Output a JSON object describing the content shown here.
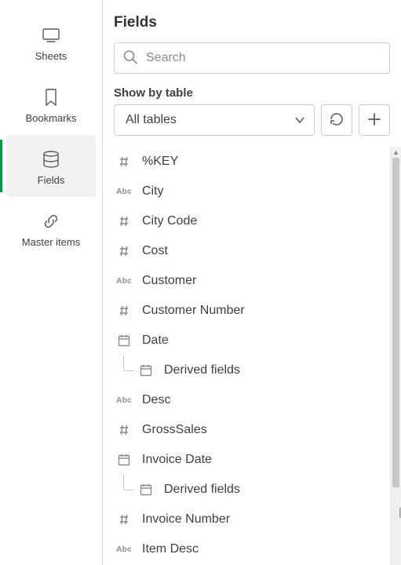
{
  "sidebar": {
    "items": [
      {
        "label": "Sheets"
      },
      {
        "label": "Bookmarks"
      },
      {
        "label": "Fields"
      },
      {
        "label": "Master items"
      }
    ],
    "activeIndex": 2
  },
  "panel": {
    "title": "Fields",
    "search_placeholder": "Search",
    "showby_label": "Show by table",
    "table_select_value": "All tables"
  },
  "fields": [
    {
      "type": "num",
      "label": "%KEY"
    },
    {
      "type": "text",
      "label": "City"
    },
    {
      "type": "num",
      "label": "City Code"
    },
    {
      "type": "num",
      "label": "Cost"
    },
    {
      "type": "text",
      "label": "Customer"
    },
    {
      "type": "num",
      "label": "Customer Number"
    },
    {
      "type": "date",
      "label": "Date"
    },
    {
      "type": "date",
      "label": "Derived fields",
      "child": true
    },
    {
      "type": "text",
      "label": "Desc"
    },
    {
      "type": "num",
      "label": "GrossSales"
    },
    {
      "type": "date",
      "label": "Invoice Date"
    },
    {
      "type": "date",
      "label": "Derived fields",
      "child": true
    },
    {
      "type": "num",
      "label": "Invoice Number"
    },
    {
      "type": "text",
      "label": "Item Desc"
    }
  ]
}
